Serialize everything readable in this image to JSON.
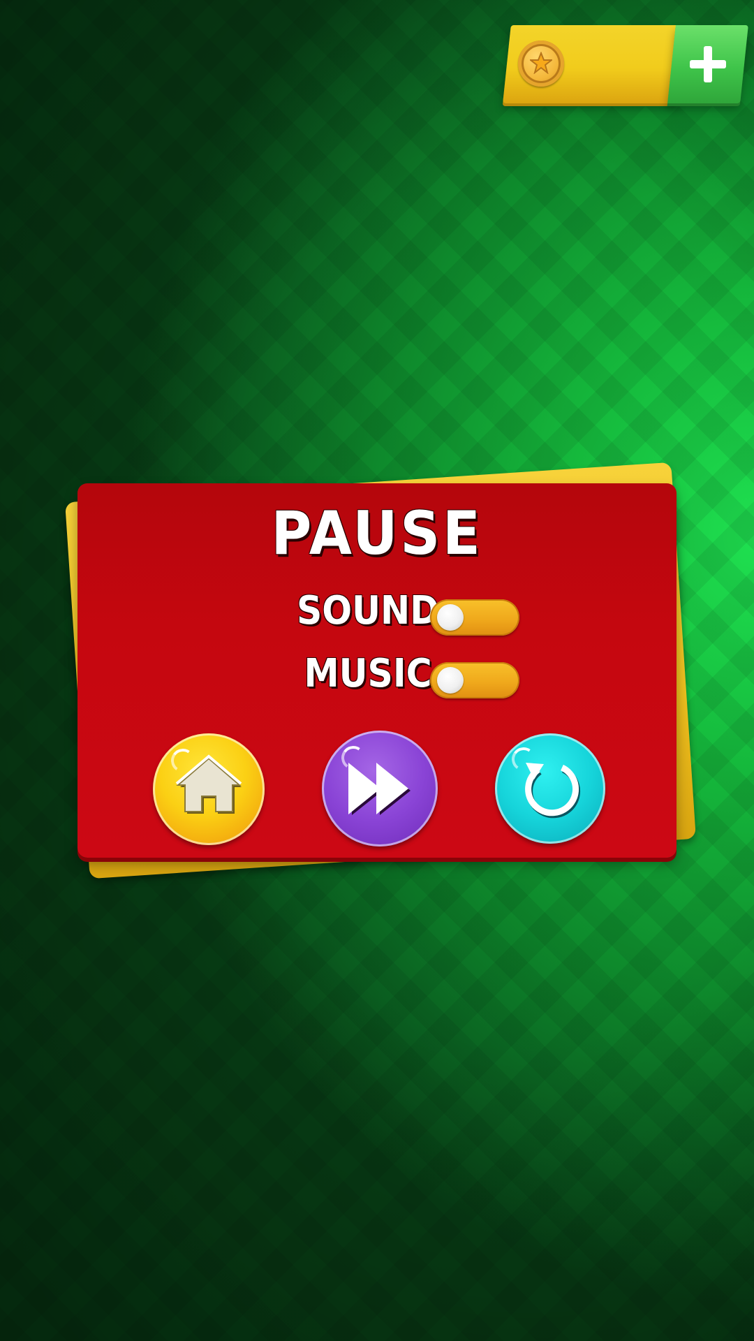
{
  "screen": {
    "name": "pause-menu"
  },
  "currency": {
    "coin_icon": "coin-star-icon",
    "amount": "",
    "add_icon": "plus-icon"
  },
  "pause_panel": {
    "title": "PAUSE",
    "settings": [
      {
        "label": "SOUND",
        "toggle_state": "off"
      },
      {
        "label": "MUSIC",
        "toggle_state": "off"
      }
    ],
    "actions": [
      {
        "icon": "home-icon",
        "color": "#f7c514"
      },
      {
        "icon": "fast-forward-icon",
        "color": "#8a44d6"
      },
      {
        "icon": "replay-icon",
        "color": "#16d4da"
      }
    ]
  },
  "colors": {
    "panel_red": "#c5070f",
    "panel_yellow": "#efc11f",
    "background_green": "#15b93c",
    "toggle_orange": "#f0a91c",
    "add_button_green": "#3fc44a"
  }
}
